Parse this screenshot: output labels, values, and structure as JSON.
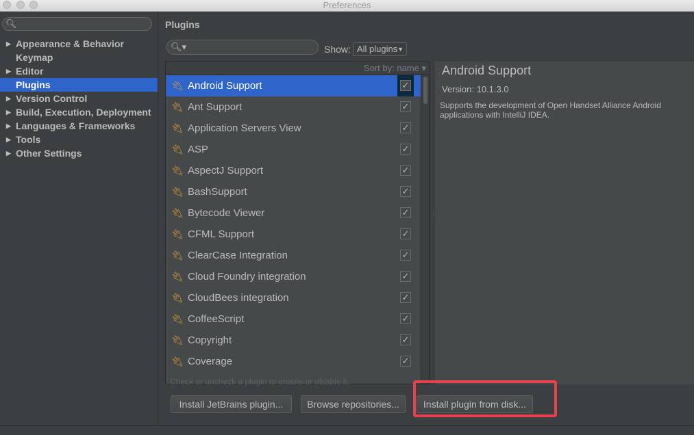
{
  "window": {
    "title": "Preferences"
  },
  "sidebar": {
    "search_icon": "search-icon",
    "items": [
      {
        "label": "Appearance & Behavior",
        "expandable": true,
        "selected": false
      },
      {
        "label": "Keymap",
        "expandable": false,
        "selected": false
      },
      {
        "label": "Editor",
        "expandable": true,
        "selected": false
      },
      {
        "label": "Plugins",
        "expandable": false,
        "selected": true
      },
      {
        "label": "Version Control",
        "expandable": true,
        "selected": false
      },
      {
        "label": "Build, Execution, Deployment",
        "expandable": true,
        "selected": false
      },
      {
        "label": "Languages & Frameworks",
        "expandable": true,
        "selected": false
      },
      {
        "label": "Tools",
        "expandable": true,
        "selected": false
      },
      {
        "label": "Other Settings",
        "expandable": true,
        "selected": false
      }
    ]
  },
  "main": {
    "title": "Plugins",
    "show_label": "Show:",
    "show_value": "All plugins",
    "sort_label": "Sort by: name ▾",
    "plugins": [
      {
        "name": "Android Support",
        "enabled": true,
        "selected": true
      },
      {
        "name": "Ant Support",
        "enabled": true,
        "selected": false
      },
      {
        "name": "Application Servers View",
        "enabled": true,
        "selected": false
      },
      {
        "name": "ASP",
        "enabled": true,
        "selected": false
      },
      {
        "name": "AspectJ Support",
        "enabled": true,
        "selected": false
      },
      {
        "name": "BashSupport",
        "enabled": true,
        "selected": false
      },
      {
        "name": "Bytecode Viewer",
        "enabled": true,
        "selected": false
      },
      {
        "name": "CFML Support",
        "enabled": true,
        "selected": false
      },
      {
        "name": "ClearCase Integration",
        "enabled": true,
        "selected": false
      },
      {
        "name": "Cloud Foundry integration",
        "enabled": true,
        "selected": false
      },
      {
        "name": "CloudBees integration",
        "enabled": true,
        "selected": false
      },
      {
        "name": "CoffeeScript",
        "enabled": true,
        "selected": false
      },
      {
        "name": "Copyright",
        "enabled": true,
        "selected": false
      },
      {
        "name": "Coverage",
        "enabled": true,
        "selected": false
      }
    ],
    "details": {
      "title": "Android Support",
      "version": "Version: 10.1.3.0",
      "description": "Supports the development of Open Handset Alliance Android applications with IntelliJ IDEA."
    },
    "hint": "Check or uncheck a plugin to enable or disable it.",
    "buttons": {
      "install_jetbrains": "Install JetBrains plugin...",
      "browse_repositories": "Browse repositories...",
      "install_from_disk": "Install plugin from disk..."
    },
    "highlight_color": "#e8414b",
    "selection_color": "#2f65ca"
  }
}
